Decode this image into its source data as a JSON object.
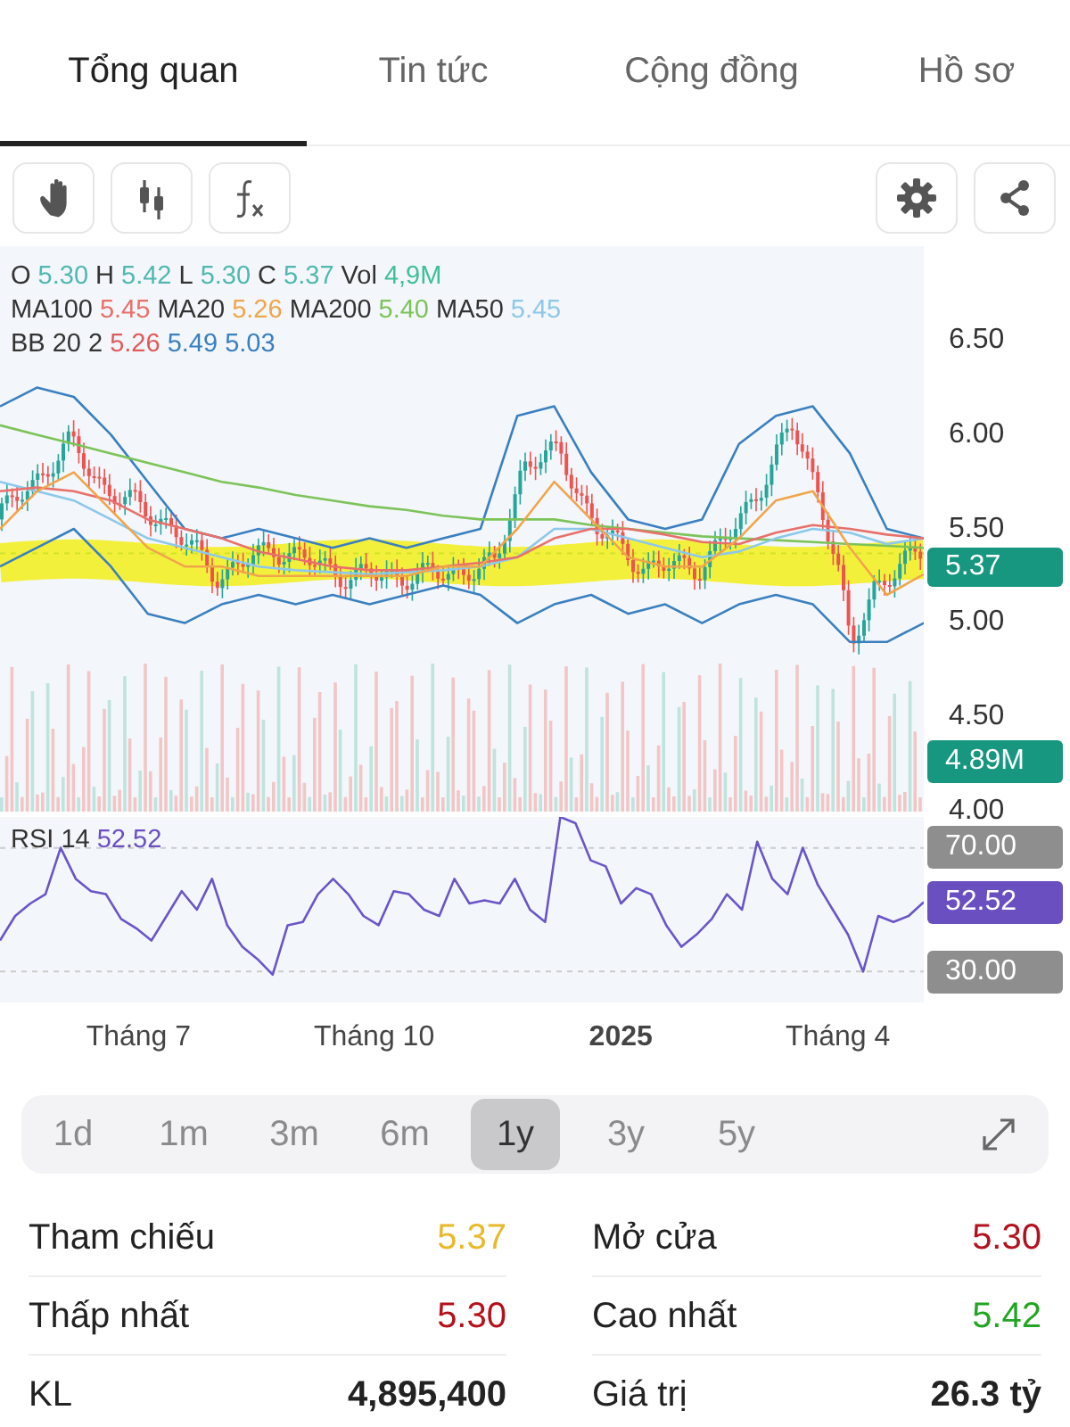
{
  "tabs": [
    {
      "label": "Tổng quan",
      "selected": true
    },
    {
      "label": "Tin tức",
      "selected": false
    },
    {
      "label": "Cộng đồng",
      "selected": false
    },
    {
      "label": "Hồ sơ",
      "selected": false
    }
  ],
  "toolbar": {
    "left": [
      {
        "kind": "hand"
      },
      {
        "kind": "candles"
      },
      {
        "kind": "function"
      }
    ],
    "right": [
      {
        "kind": "settings"
      },
      {
        "kind": "share"
      }
    ]
  },
  "price_pane": {
    "legend": [
      {
        "items": [
          {
            "label": "O",
            "value": "5.30",
            "color": "#4fb8b0"
          },
          {
            "label": "H",
            "value": "5.42",
            "color": "#4fb8b0"
          },
          {
            "label": "L",
            "value": "5.30",
            "color": "#4fb8b0"
          },
          {
            "label": "C",
            "value": "5.37",
            "color": "#4fb8b0"
          },
          {
            "label": "Vol",
            "value": "4,9M",
            "color": "#3fbf9a"
          }
        ]
      },
      {
        "items": [
          {
            "label": "MA100",
            "value": "5.45",
            "color": "#e8706a"
          },
          {
            "label": "MA20",
            "value": "5.26",
            "color": "#f0a54a"
          },
          {
            "label": "MA200",
            "value": "5.40",
            "color": "#7cc35a"
          },
          {
            "label": "MA50",
            "value": "5.45",
            "color": "#8cc8ea"
          }
        ]
      },
      {
        "items": [
          {
            "label": "BB 20 2",
            "value": "5.26",
            "color": "#e05a5a"
          },
          {
            "value": "5.49",
            "color": "#3a7fc0"
          },
          {
            "value": "5.03",
            "color": "#3a7fc0"
          }
        ]
      }
    ],
    "chart_data": {
      "type": "line",
      "ylim": [
        4.0,
        7.0
      ],
      "yticks": [
        {
          "value": 6.5,
          "label": "6.50"
        },
        {
          "value": 6.0,
          "label": "6.00"
        },
        {
          "value": 5.5,
          "label": "5.50"
        },
        {
          "value": 5.0,
          "label": "5.00"
        },
        {
          "value": 4.5,
          "label": "4.50"
        },
        {
          "value": 4.0,
          "label": "4.00"
        }
      ],
      "series": [
        {
          "color": "#3a7fc0",
          "values": [
            6.15,
            6.25,
            6.2,
            6.0,
            5.75,
            5.5,
            5.45,
            5.5,
            5.45,
            5.4,
            5.45,
            5.4,
            5.45,
            5.5,
            6.1,
            6.15,
            5.8,
            5.55,
            5.5,
            5.55,
            5.95,
            6.1,
            6.15,
            5.9,
            5.5,
            5.45
          ]
        },
        {
          "color": "#3a7fc0",
          "values": [
            5.3,
            5.4,
            5.5,
            5.3,
            5.05,
            5.0,
            5.1,
            5.15,
            5.1,
            5.15,
            5.1,
            5.15,
            5.2,
            5.15,
            5.0,
            5.1,
            5.15,
            5.05,
            5.1,
            5.0,
            5.1,
            5.15,
            5.1,
            4.9,
            4.9,
            5.0
          ]
        },
        {
          "color": "#7cc35a",
          "values": [
            6.05,
            6.0,
            5.95,
            5.9,
            5.85,
            5.8,
            5.75,
            5.72,
            5.68,
            5.65,
            5.62,
            5.6,
            5.57,
            5.55,
            5.55,
            5.55,
            5.52,
            5.5,
            5.48,
            5.46,
            5.45,
            5.44,
            5.43,
            5.42,
            5.41,
            5.4
          ]
        },
        {
          "color": "#8cc8ea",
          "values": [
            5.75,
            5.7,
            5.65,
            5.55,
            5.45,
            5.4,
            5.35,
            5.3,
            5.28,
            5.27,
            5.26,
            5.27,
            5.28,
            5.3,
            5.35,
            5.5,
            5.5,
            5.45,
            5.4,
            5.35,
            5.38,
            5.45,
            5.5,
            5.48,
            5.42,
            5.45
          ]
        },
        {
          "color": "#e8706a",
          "values": [
            5.7,
            5.72,
            5.7,
            5.65,
            5.55,
            5.5,
            5.45,
            5.38,
            5.34,
            5.3,
            5.28,
            5.28,
            5.3,
            5.32,
            5.35,
            5.45,
            5.5,
            5.5,
            5.47,
            5.43,
            5.42,
            5.48,
            5.52,
            5.5,
            5.47,
            5.45
          ]
        },
        {
          "color": "#f0a54a",
          "values": [
            5.5,
            5.7,
            5.8,
            5.6,
            5.4,
            5.3,
            5.3,
            5.25,
            5.25,
            5.25,
            5.25,
            5.25,
            5.3,
            5.3,
            5.5,
            5.75,
            5.55,
            5.35,
            5.3,
            5.3,
            5.45,
            5.65,
            5.7,
            5.4,
            5.15,
            5.26
          ]
        }
      ]
    },
    "price_badge": {
      "text": "5.37",
      "color": "#17977f"
    },
    "volume_badge": {
      "text": "4.89M",
      "color": "#17977f"
    }
  },
  "rsi_pane": {
    "label": "RSI 14",
    "value": "52.52",
    "chart_data": {
      "type": "line",
      "ylim": [
        20,
        80
      ],
      "yticks": [
        {
          "value": 70,
          "label": "70.00"
        },
        {
          "value": 30,
          "label": "30.00"
        }
      ],
      "series": [
        {
          "color": "#6a55c8",
          "values": [
            40,
            48,
            52,
            55,
            70,
            60,
            56,
            55,
            47,
            44,
            40,
            48,
            56,
            50,
            60,
            45,
            38,
            34,
            29,
            45,
            46,
            55,
            60,
            55,
            48,
            45,
            56,
            55,
            50,
            48,
            60,
            52,
            53,
            52,
            60,
            50,
            46,
            80,
            78,
            66,
            64,
            52,
            57,
            55,
            45,
            38,
            42,
            47,
            55,
            50,
            72,
            60,
            55,
            70,
            58,
            50,
            42,
            30,
            48,
            46,
            48,
            52.5
          ]
        }
      ]
    },
    "value_badge": {
      "text": "52.52",
      "color": "#6a4fc0"
    }
  },
  "x_axis": [
    {
      "text": "Tháng 7",
      "bold": false
    },
    {
      "text": "Tháng 10",
      "bold": false
    },
    {
      "text": "2025",
      "bold": true
    },
    {
      "text": "Tháng 4",
      "bold": false
    }
  ],
  "periods": [
    {
      "label": "1d",
      "selected": false
    },
    {
      "label": "1m",
      "selected": false
    },
    {
      "label": "3m",
      "selected": false
    },
    {
      "label": "6m",
      "selected": false
    },
    {
      "label": "1y",
      "selected": true
    },
    {
      "label": "3y",
      "selected": false
    },
    {
      "label": "5y",
      "selected": false
    }
  ],
  "stats": [
    {
      "label": "Tham chiếu",
      "value": "5.37",
      "color": "#e8b92a",
      "bold": false
    },
    {
      "label": "Mở cửa",
      "value": "5.30",
      "color": "#b3111c",
      "bold": false
    },
    {
      "label": "Thấp nhất",
      "value": "5.30",
      "color": "#b3111c",
      "bold": false
    },
    {
      "label": "Cao nhất",
      "value": "5.42",
      "color": "#23a524",
      "bold": false
    },
    {
      "label": "KL",
      "value": "4,895,400",
      "color": "#222222",
      "bold": true
    },
    {
      "label": "Giá trị",
      "value": "26.3 tỷ",
      "color": "#222222",
      "bold": true
    }
  ]
}
